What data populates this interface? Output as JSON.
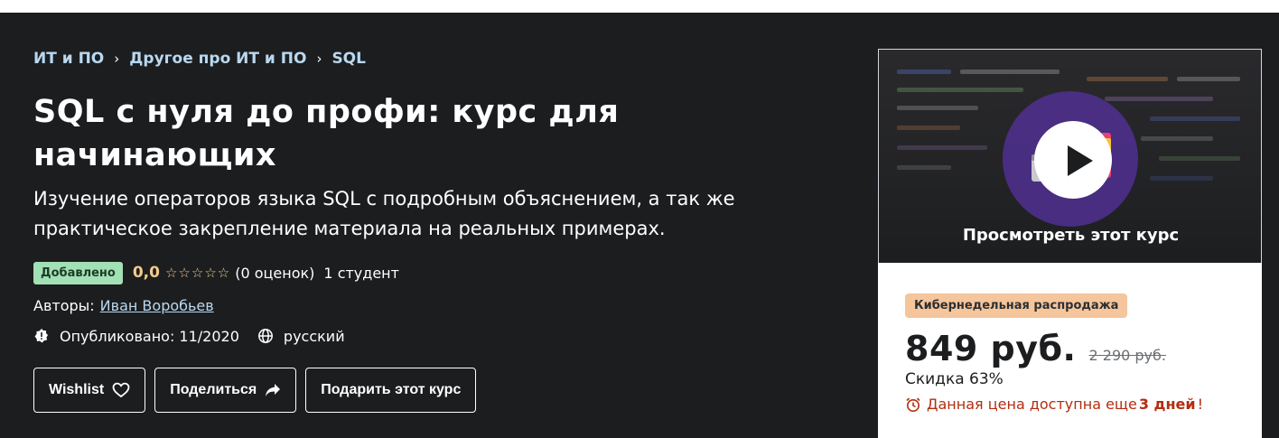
{
  "breadcrumb": {
    "items": [
      "ИТ и ПО",
      "Другое про ИТ и ПО",
      "SQL"
    ],
    "separator": "›"
  },
  "course": {
    "title": "SQL с нуля до профи: курс для начинающих",
    "subtitle": "Изучение операторов языка SQL с подробным объяснением, а так же практическое закрепление материала на реальных примерах.",
    "badge": "Добавлено",
    "rating": "0,0",
    "stars": 5,
    "rating_count": "(0 оценок)",
    "students": "1 студент",
    "authors_label": "Авторы:",
    "author": "Иван Воробьев",
    "published": "Опубликовано: 11/2020",
    "language": "русский"
  },
  "buttons": {
    "wishlist": "Wishlist",
    "share": "Поделиться",
    "gift": "Подарить этот курс"
  },
  "preview": {
    "label": "Просмотреть этот курс"
  },
  "pricing": {
    "sale_badge": "Кибернедельная распродажа",
    "current": "849 руб.",
    "old": "2 290 руб.",
    "discount": "Скидка 63%",
    "timer_prefix": "Данная цена доступна еще",
    "timer_days": "3 дней",
    "timer_suffix": "!"
  },
  "colors": {
    "background": "#1c1d1f",
    "breadcrumb_link": "#b9d8f0",
    "rating": "#f3ca8c",
    "badge_added": "#a2e0b5",
    "play_circle": "#4b2e86",
    "sale_badge": "#f5c59c",
    "timer": "#b32d0f"
  },
  "icons": {
    "breadcrumb_separator": "chevron-right-icon",
    "star": "star-outline-icon",
    "published": "alert-badge-icon",
    "language": "globe-icon",
    "wishlist": "heart-icon",
    "share": "share-arrow-icon",
    "play": "play-icon",
    "timer": "alarm-clock-icon"
  }
}
